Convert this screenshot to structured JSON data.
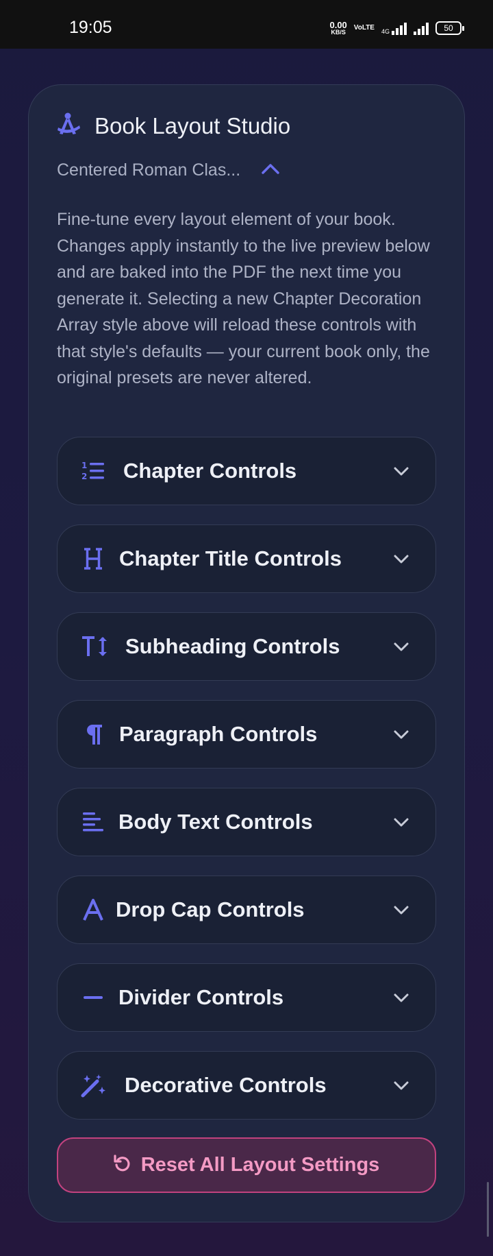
{
  "status_bar": {
    "time": "19:05",
    "net_speed_value": "0.00",
    "net_speed_unit": "KB/S",
    "volte": "VoLTE",
    "network": "4G",
    "battery": "50"
  },
  "card": {
    "title": "Book Layout Studio",
    "preset": "Centered Roman Clas...",
    "description": "Fine-tune every layout element of your book. Changes apply instantly to the live preview below and are baked into the PDF the next time you generate it. Selecting a new Chapter Decoration Array style above will reload these controls with that style's defaults — your current book only, the original presets are never altered.",
    "sections": [
      {
        "label": "Chapter Controls",
        "icon": "list-ordered-icon"
      },
      {
        "label": "Chapter Title Controls",
        "icon": "heading-icon"
      },
      {
        "label": "Subheading Controls",
        "icon": "text-height-icon"
      },
      {
        "label": "Paragraph Controls",
        "icon": "paragraph-icon"
      },
      {
        "label": "Body Text Controls",
        "icon": "align-left-icon"
      },
      {
        "label": "Drop Cap Controls",
        "icon": "letter-a-icon"
      },
      {
        "label": "Divider Controls",
        "icon": "minus-icon"
      },
      {
        "label": "Decorative Controls",
        "icon": "magic-wand-icon"
      }
    ],
    "reset_label": "Reset All Layout Settings"
  },
  "colors": {
    "accent": "#6b6ff0",
    "card_bg": "#1f2640",
    "reset_border": "#c2427f",
    "reset_text": "#f49ac4"
  }
}
